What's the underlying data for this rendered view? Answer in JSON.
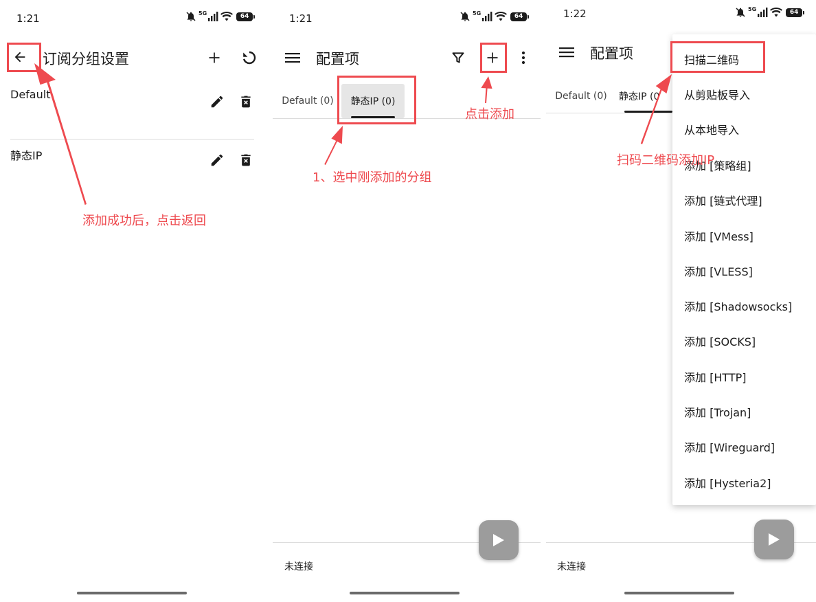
{
  "screen1": {
    "time": "1:21",
    "battery": "64",
    "network": "5G",
    "title": "订阅分组设置",
    "groups": [
      {
        "name": "Default"
      },
      {
        "name": "静态IP"
      }
    ]
  },
  "screen2": {
    "time": "1:21",
    "battery": "64",
    "network": "5G",
    "title": "配置项",
    "tabs": [
      {
        "label": "Default (0)"
      },
      {
        "label": "静态IP (0)"
      }
    ],
    "status": "未连接"
  },
  "screen3": {
    "time": "1:22",
    "battery": "64",
    "network": "5G",
    "title": "配置项",
    "tabs": [
      {
        "label": "Default (0)"
      },
      {
        "label": "静态IP (0"
      }
    ],
    "status": "未连接",
    "menu": [
      "扫描二维码",
      "从剪贴板导入",
      "从本地导入",
      "添加 [策略组]",
      "添加 [链式代理]",
      "添加 [VMess]",
      "添加 [VLESS]",
      "添加 [Shadowsocks]",
      "添加 [SOCKS]",
      "添加 [HTTP]",
      "添加 [Trojan]",
      "添加 [Wireguard]",
      "添加 [Hysteria2]"
    ]
  },
  "annotations": {
    "back_note": "添加成功后，点击返回",
    "select_group_note": "1、选中刚添加的分组",
    "click_add_note": "点击添加",
    "scan_qr_note": "扫码二维码添加IP"
  },
  "colors": {
    "annotation_red": "#ee4a4f",
    "fab_gray": "#9c9c9c",
    "active_tab_bg": "#e6e6e6"
  }
}
